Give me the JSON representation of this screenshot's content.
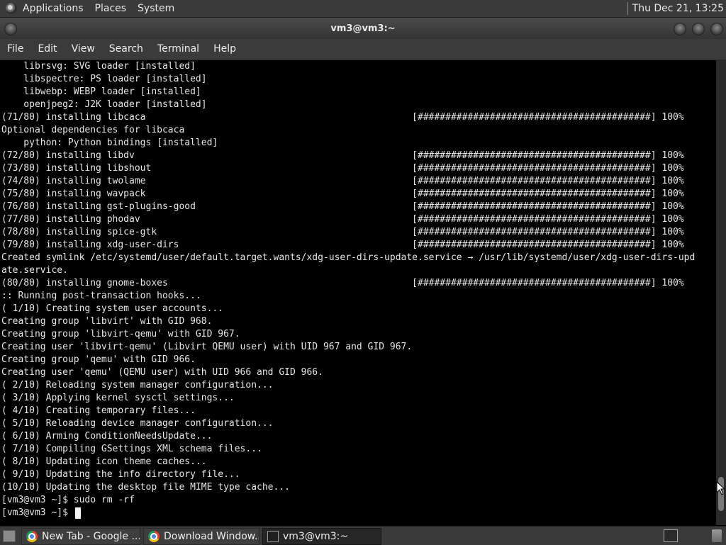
{
  "top_panel": {
    "menus": [
      "Applications",
      "Places",
      "System"
    ],
    "clock": "Thu Dec 21, 13:25"
  },
  "window": {
    "title": "vm3@vm3:~"
  },
  "menubar": {
    "items": [
      "File",
      "Edit",
      "View",
      "Search",
      "Terminal",
      "Help"
    ]
  },
  "terminal": {
    "lines": [
      "    librsvg: SVG loader [installed]",
      "    libspectre: PS loader [installed]",
      "    libwebp: WEBP loader [installed]",
      "    openjpeg2: J2K loader [installed]",
      "(71/80) installing libcaca                                                [##########################################] 100%",
      "Optional dependencies for libcaca",
      "    python: Python bindings [installed]",
      "(72/80) installing libdv                                                  [##########################################] 100%",
      "(73/80) installing libshout                                               [##########################################] 100%",
      "(74/80) installing twolame                                                [##########################################] 100%",
      "(75/80) installing wavpack                                                [##########################################] 100%",
      "(76/80) installing gst-plugins-good                                       [##########################################] 100%",
      "(77/80) installing phodav                                                 [##########################################] 100%",
      "(78/80) installing spice-gtk                                              [##########################################] 100%",
      "(79/80) installing xdg-user-dirs                                          [##########################################] 100%",
      "Created symlink /etc/systemd/user/default.target.wants/xdg-user-dirs-update.service → /usr/lib/systemd/user/xdg-user-dirs-upd",
      "ate.service.",
      "(80/80) installing gnome-boxes                                            [##########################################] 100%",
      ":: Running post-transaction hooks...",
      "( 1/10) Creating system user accounts...",
      "Creating group 'libvirt' with GID 968.",
      "Creating group 'libvirt-qemu' with GID 967.",
      "Creating user 'libvirt-qemu' (Libvirt QEMU user) with UID 967 and GID 967.",
      "Creating group 'qemu' with GID 966.",
      "Creating user 'qemu' (QEMU user) with UID 966 and GID 966.",
      "( 2/10) Reloading system manager configuration...",
      "( 3/10) Applying kernel sysctl settings...",
      "( 4/10) Creating temporary files...",
      "( 5/10) Reloading device manager configuration...",
      "( 6/10) Arming ConditionNeedsUpdate...",
      "( 7/10) Compiling GSettings XML schema files...",
      "( 8/10) Updating icon theme caches...",
      "( 9/10) Updating the info directory file...",
      "(10/10) Updating the desktop file MIME type cache...",
      "[vm3@vm3 ~]$ sudo rm -rf",
      "[vm3@vm3 ~]$ "
    ]
  },
  "taskbar": {
    "tasks": [
      {
        "label": "New Tab - Google ...",
        "icon": "chrome-icon",
        "active": false
      },
      {
        "label": "Download Window...",
        "icon": "chrome-icon",
        "active": false
      },
      {
        "label": "vm3@vm3:~",
        "icon": "terminal-icon",
        "active": true
      }
    ]
  },
  "colors": {
    "terminal_bg": "#000000",
    "terminal_fg": "#e6e6e6",
    "panel_bg": "#3a3a3a"
  }
}
